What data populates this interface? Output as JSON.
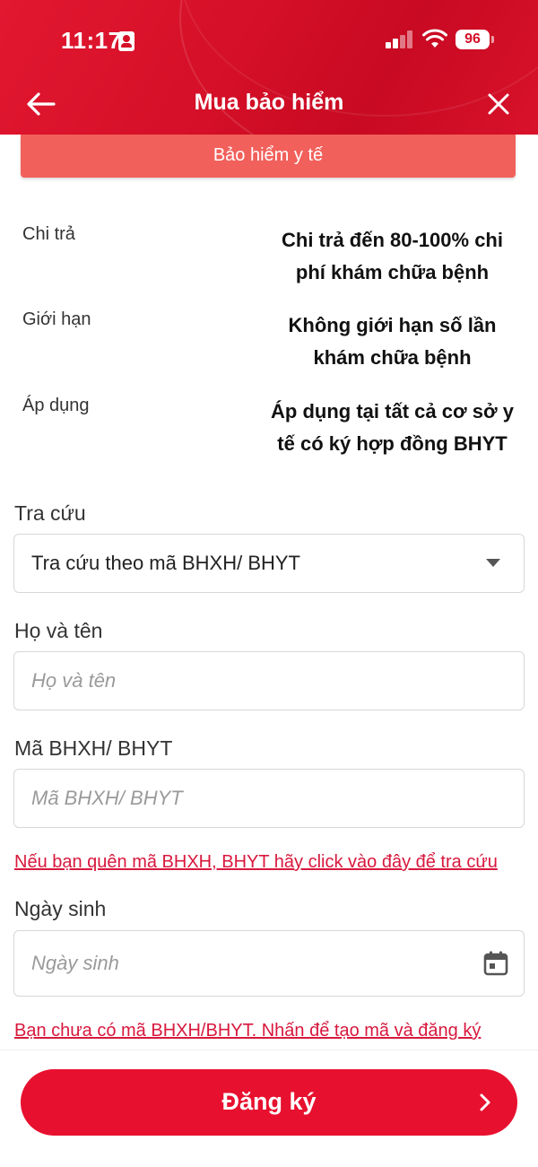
{
  "status_bar": {
    "time": "11:17",
    "battery": "96"
  },
  "header": {
    "title": "Mua bảo hiểm",
    "back_icon": "arrow-left-icon",
    "close_icon": "close-icon"
  },
  "tab": {
    "label": "Bảo hiểm y tế"
  },
  "benefits": [
    {
      "label": "Chi trả",
      "value_line1": "Chi trả đến 80-100% chi",
      "value_line2": "phí khám chữa bệnh"
    },
    {
      "label": "Giới hạn",
      "value_line1": "Không giới hạn số lần",
      "value_line2": "khám chữa bệnh"
    },
    {
      "label": "Áp dụng",
      "value_line1": "Áp dụng tại tất cả cơ sở y",
      "value_line2": "tế có ký hợp đồng BHYT"
    }
  ],
  "form": {
    "lookup": {
      "label": "Tra cứu",
      "value": "Tra cứu theo mã BHXH/ BHYT"
    },
    "full_name": {
      "label": "Họ và tên",
      "placeholder": "Họ và tên"
    },
    "insurance_code": {
      "label": "Mã BHXH/ BHYT",
      "placeholder": "Mã BHXH/ BHYT"
    },
    "forgot_code_link": "Nếu bạn quên mã BHXH, BHYT hãy click vào đây để tra cứu",
    "birth_date": {
      "label": "Ngày sinh",
      "placeholder": "Ngày sinh"
    },
    "no_code_link": "Bạn chưa có mã BHXH/BHYT. Nhấn để tạo mã và đăng ký"
  },
  "submit": {
    "label": "Đăng ký"
  },
  "colors": {
    "brand_red": "#e8102f",
    "tab_red": "#f2605b",
    "link_red": "#d8183d"
  }
}
